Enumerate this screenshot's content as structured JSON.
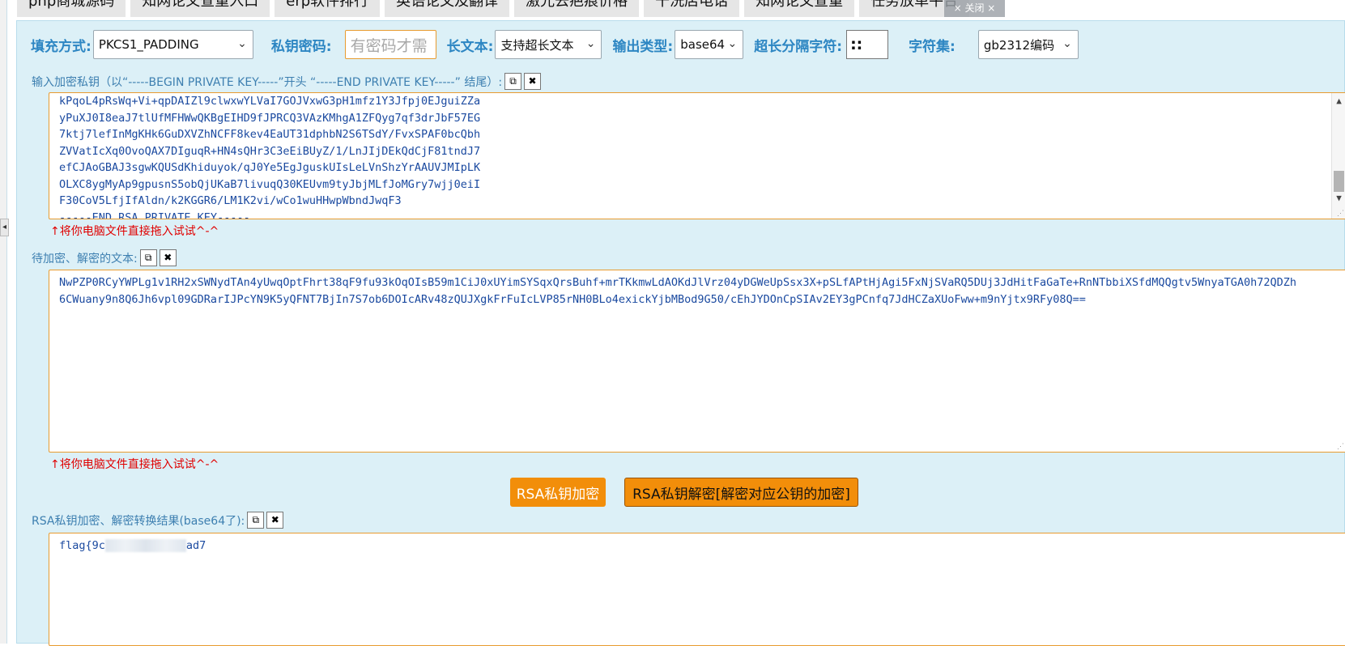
{
  "top_ads": [
    "php商城源码",
    "知网论文查重入口",
    "erp软件排行",
    "英语论文及翻译",
    "激光去疤痕价格",
    "干洗店电话",
    "知网论文查重",
    "任务放单平台"
  ],
  "top_ads_close": "× 关闭 ×",
  "options": {
    "padding_label": "填充方式:",
    "padding_value": "PKCS1_PADDING",
    "password_label": "私钥密码:",
    "password_placeholder": "有密码才需",
    "longtext_label": "长文本:",
    "longtext_value": "支持超长文本",
    "output_label": "输出类型:",
    "output_value": "base64",
    "separator_label": "超长分隔字符:",
    "separator_value": "::",
    "charset_label": "字符集:",
    "charset_value": "gb2312编码"
  },
  "key_section": {
    "caption": "输入加密私钥（以“-----BEGIN PRIVATE KEY-----”开头 “-----END PRIVATE KEY-----” 结尾）:",
    "lines": [
      "kPqoL4pRsWq+Vi+qpDAIZl9clwxwYLVaI7GOJVxwG3pH1mfz1Y3Jfpj0EJguiZZa",
      "yPuXJ0I8eaJ7tlUfMFHWwQKBgEIHD9fJPRCQ3VAzKMhgA1ZFQyg7qf3drJbF57EG",
      "7ktj7lefInMgKHk6GuDXVZhNCFF8kev4EaUT31dphbN2S6TSdY/FvxSPAF0bcQbh",
      "ZVVatIcXq0OvoQAX7DIguqR+HN4sQHr3C3eEiBUyZ/1/LnJIjDEkQdCjF81tndJ7",
      "efCJAoGBAJ3sgwKQUSdKhiduyok/qJ0Ye5EgJguskUIsLeLVnShzYrAAUVJMIpLK",
      "OLXC8ygMyAp9gpusnS5obQjUKaB7livuqQ30KEUvm9tyJbjMLfJoMGry7wjj0eiI",
      "F30CoV5LfjIfAldn/k2KGGR6/LM1K2vi/wCo1wuHHwpWbndJwqF3",
      "-----END RSA PRIVATE KEY-----"
    ],
    "hint": "↑将你电脑文件直接拖入试试^-^"
  },
  "text_section": {
    "caption": "待加密、解密的文本:",
    "content": "NwPZP0RCyYWPLg1v1RH2xSWNydTAn4yUwqOptFhrt38qF9fu93kOqOIsB59m1CiJ0xUYimSYSqxQrsBuhf+mrTKkmwLdAOKdJlVrz04yDGWeUpSsx3X+pSLfAPtHjAgi5FxNjSVaRQ5DUj3JdHitFaGaTe+RnNTbbiXSfdMQQgtv5WnyaTGA0h72QDZh6CWuany9n8Q6Jh6vpl09GDRarIJPcYN9K5yQFNT7BjIn7S7ob6DOIcARv48zQUJXgkFrFuIcLVP85rNH0BLo4exickYjbMBod9G50/cEhJYDOnCpSIAv2EY3gPCnfq7JdHCZaXUoFww+m9nYjtx9RFy08Q==",
    "hint": "↑将你电脑文件直接拖入试试^-^"
  },
  "buttons": {
    "encrypt": "RSA私钥加密",
    "decrypt": "RSA私钥解密[解密对应公钥的加密]"
  },
  "result_section": {
    "caption": "RSA私钥加密、解密转换结果(base64了):",
    "prefix": "flag{9c",
    "suffix": "ad7"
  },
  "icons": {
    "copy": "copy-icon",
    "clear": "clear-icon",
    "chevron": "chevron-down-icon"
  },
  "colors": {
    "panel_bg": "#dcf0f7",
    "label": "#2d86c3",
    "accent_orange": "#f28e0a",
    "hint_red": "#e00000",
    "text_blue": "#1b4aa0"
  }
}
